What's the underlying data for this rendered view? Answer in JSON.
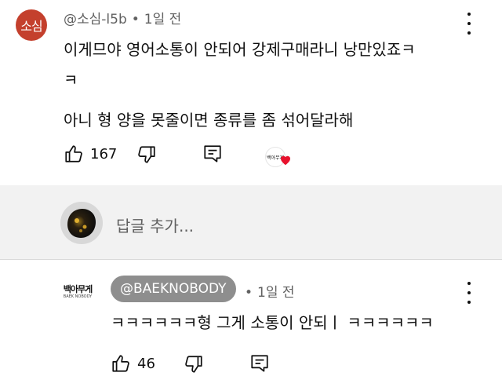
{
  "comment": {
    "avatar_text": "소심",
    "avatar_color": "#c4402d",
    "handle": "@소심-l5b",
    "separator": "•",
    "time": "1일 전",
    "text_line1": "이게므야 영어소통이 안되어 강제구매라니 낭만있죠ㅋ",
    "text_line2": "ㅋ",
    "text_para2": "아니 형 양을 못줄이면 종류를 좀 섞어달라해",
    "like_count": "167",
    "creator_heart_logo": "백아무게",
    "icons": {
      "like": "thumbs-up-icon",
      "dislike": "thumbs-down-icon",
      "reply": "reply-icon",
      "menu": "more-vertical-icon",
      "heart": "creator-heart-icon"
    },
    "heart_color": "#e8112d"
  },
  "reply_box": {
    "placeholder": "답글 추가..."
  },
  "reply": {
    "logo_text": "백아무게",
    "logo_sub": "BAEK NOBODY",
    "handle": "@BAEKNOBODY",
    "separator": "•",
    "time": "1일 전",
    "text": "ㅋㅋㅋㅋㅋㅋ형 그게 소통이 안되ㅣ ㅋㅋㅋㅋㅋㅋ",
    "like_count": "46",
    "pill_color": "#8e8e8e"
  }
}
